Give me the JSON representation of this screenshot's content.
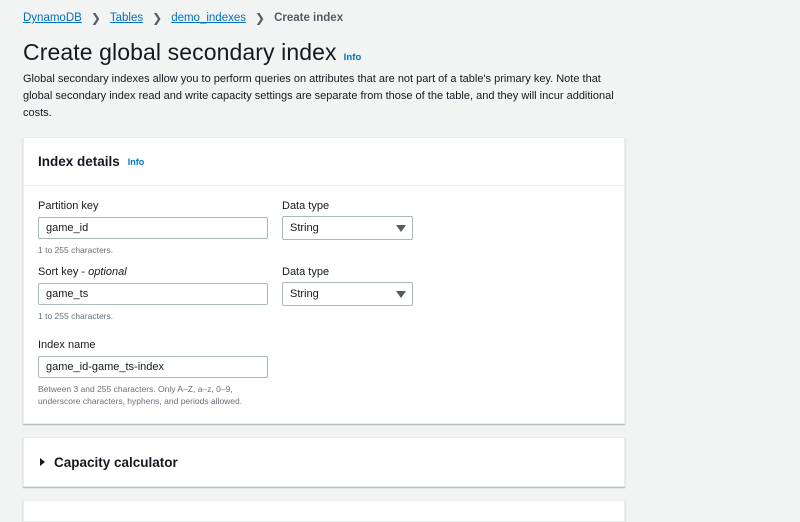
{
  "breadcrumb": {
    "items": [
      "DynamoDB",
      "Tables",
      "demo_indexes"
    ],
    "current": "Create index"
  },
  "page": {
    "title": "Create global secondary index",
    "info": "Info",
    "description": "Global secondary indexes allow you to perform queries on attributes that are not part of a table's primary key. Note that global secondary index read and write capacity settings are separate from those of the table, and they will incur additional costs."
  },
  "index_details": {
    "title": "Index details",
    "info": "Info",
    "partition_key": {
      "label": "Partition key",
      "value": "game_id",
      "hint": "1 to 255 characters."
    },
    "partition_type": {
      "label": "Data type",
      "value": "String"
    },
    "sort_key": {
      "label": "Sort key",
      "optional": "optional",
      "value": "game_ts",
      "hint": "1 to 255 characters."
    },
    "sort_type": {
      "label": "Data type",
      "value": "String"
    },
    "index_name": {
      "label": "Index name",
      "value": "game_id-game_ts-index",
      "hint_line1": "Between 3 and 255 characters. Only A–Z, a–z, 0–9,",
      "hint_line2": "underscore characters, hyphens, and periods allowed."
    }
  },
  "capacity": {
    "title": "Capacity calculator"
  },
  "icons": {
    "breadcrumb_separator": "chevron-right-icon",
    "dropdown": "caret-down-icon",
    "expand": "caret-right-icon"
  },
  "colors": {
    "link": "#0073bb",
    "background": "#f2f3f3",
    "panel": "#ffffff"
  }
}
